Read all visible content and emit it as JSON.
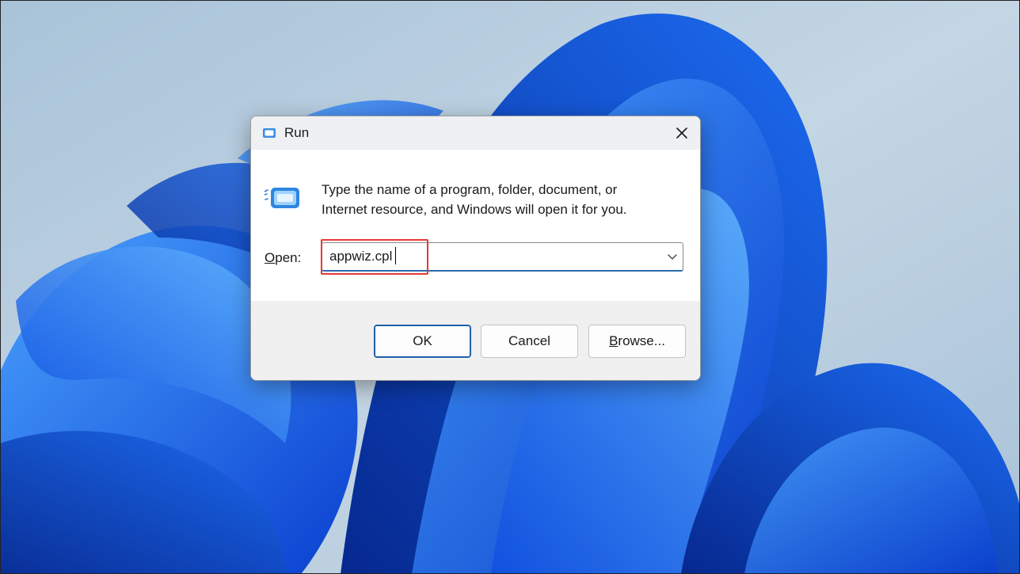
{
  "dialog": {
    "title": "Run",
    "title_icon": "run-app-icon",
    "close_icon": "close-icon",
    "description_line1": "Type the name of a program, folder, document, or",
    "description_line2": "Internet resource, and Windows will open it for you.",
    "open_label_accesskey": "O",
    "open_label_rest": "pen:",
    "open_value": "appwiz.cpl",
    "dropdown_icon": "chevron-down-icon",
    "buttons": {
      "ok": "OK",
      "cancel": "Cancel",
      "browse_accesskey": "B",
      "browse_rest": "rowse..."
    }
  },
  "colors": {
    "highlight_box": "#e53935",
    "input_focus_underline": "#2b6cb0",
    "default_button_border": "#1e5fa8",
    "wallpaper_bloom": "#1f5fe0",
    "wallpaper_background": "#b9cfe0"
  }
}
